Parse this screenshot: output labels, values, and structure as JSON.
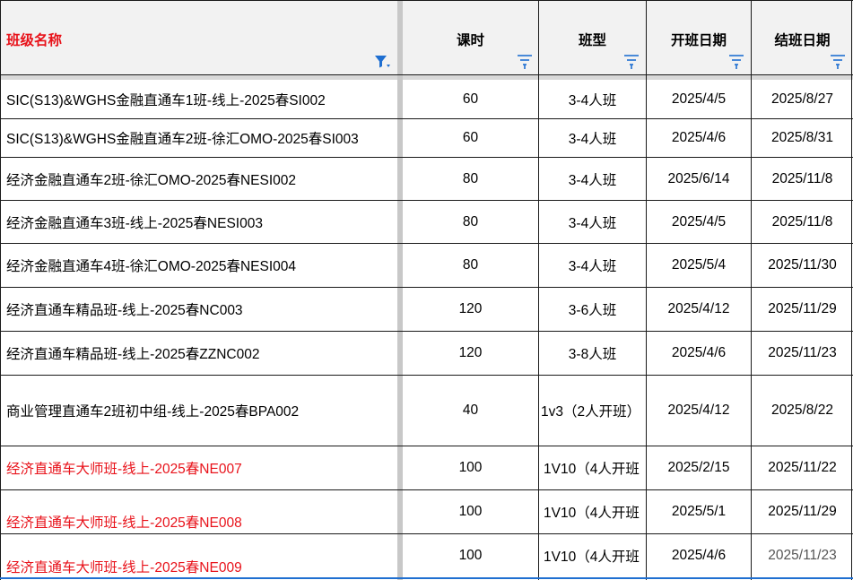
{
  "headers": {
    "name": "班级名称",
    "hours": "课时",
    "type": "班型",
    "start": "开班日期",
    "end": "结班日期"
  },
  "rows": [
    {
      "name": "SIC(S13)&WGHS金融直通车1班-线上-2025春SI002",
      "hours": "60",
      "type": "3-4人班",
      "start": "2025/4/5",
      "end": "2025/8/27"
    },
    {
      "name": "SIC(S13)&WGHS金融直通车2班-徐汇OMO-2025春SI003",
      "hours": "60",
      "type": "3-4人班",
      "start": "2025/4/6",
      "end": "2025/8/31"
    },
    {
      "name": "经济金融直通车2班-徐汇OMO-2025春NESI002",
      "hours": "80",
      "type": "3-4人班",
      "start": "2025/6/14",
      "end": "2025/11/8"
    },
    {
      "name": "经济金融直通车3班-线上-2025春NESI003",
      "hours": "80",
      "type": "3-4人班",
      "start": "2025/4/5",
      "end": "2025/11/8"
    },
    {
      "name": "经济金融直通车4班-徐汇OMO-2025春NESI004",
      "hours": "80",
      "type": "3-4人班",
      "start": "2025/5/4",
      "end": "2025/11/30"
    },
    {
      "name": "经济直通车精品班-线上-2025春NC003",
      "hours": "120",
      "type": "3-6人班",
      "start": "2025/4/12",
      "end": "2025/11/29"
    },
    {
      "name": "经济直通车精品班-线上-2025春ZZNC002",
      "hours": "120",
      "type": "3-8人班",
      "start": "2025/4/6",
      "end": "2025/11/23"
    },
    {
      "name": "商业管理直通车2班初中组-线上-2025春BPA002",
      "hours": "40",
      "type": "1v3（2人开班）",
      "start": "2025/4/12",
      "end": "2025/8/22"
    },
    {
      "name": "经济直通车大师班-线上-2025春NE007",
      "hours": "100",
      "type": "1V10（4人开班",
      "start": "2025/2/15",
      "end": "2025/11/22"
    },
    {
      "name": "经济直通车大师班-线上-2025春NE008",
      "hours": "100",
      "type": "1V10（4人开班",
      "start": "2025/5/1",
      "end": "2025/11/29"
    },
    {
      "name": "经济直通车大师班-线上-2025春NE009",
      "hours": "100",
      "type": "1V10（4人开班",
      "start": "2025/4/6",
      "end": "2025/11/23"
    }
  ],
  "colors": {
    "red_text": "#e8121a",
    "filter_icon": "#1f6fd1",
    "header_bg": "#f2f2f2"
  }
}
